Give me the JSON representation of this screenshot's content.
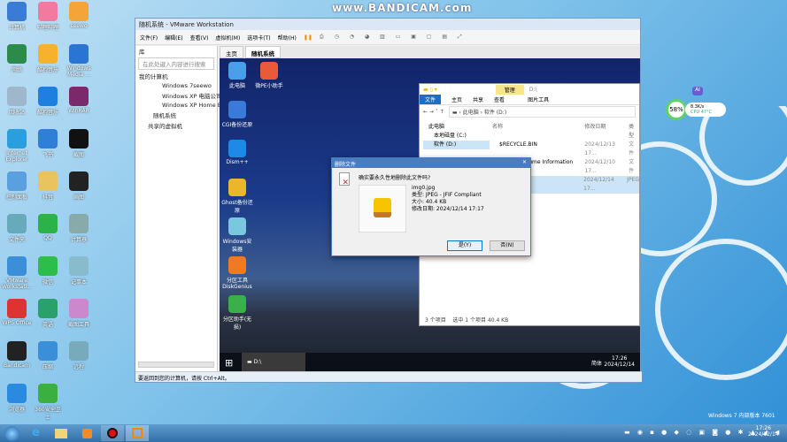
{
  "watermark": "www.BANDICAM.com",
  "host_desktop": {
    "icons": [
      "计算机",
      "哔哩哔哩",
      "seewo",
      "网络",
      "酷狗音乐",
      "Windows Media ...",
      "回收站",
      "酷狗音乐",
      "WinRAR",
      "Internet Explorer",
      "飞书",
      "截图",
      "控制面板",
      "抖音",
      "画图",
      "文件夹",
      "QQ",
      "计算器",
      "VMware Workstati...",
      "微信",
      "记事本",
      "WPS Office",
      "英语",
      "截图工具",
      "Bandicam",
      "压缩",
      "远程",
      "浏览器",
      "360安全卫士"
    ],
    "widget": {
      "ai": "AI",
      "percent": "58%",
      "speed": "8.3K/s",
      "cpu": "CPU 47°C"
    },
    "version_text": "Windows 7 内部版本 7601",
    "clock": {
      "time": "17:26",
      "date": "2024/12/14"
    }
  },
  "vmware": {
    "title": "随机系统 - VMware Workstation",
    "menu": [
      "文件(F)",
      "编辑(E)",
      "查看(V)",
      "虚拟机(M)",
      "选项卡(T)",
      "帮助(H)"
    ],
    "library": {
      "title": "库",
      "search_placeholder": "在此处键入内容进行搜索",
      "tree": [
        "我的计算机",
        "Windows 7seewo",
        "Windows XP 电脑公司",
        "Windows XP Home Ed",
        "随机系统",
        "共享的虚拟机"
      ]
    },
    "tabs": [
      "主页",
      "随机系统"
    ],
    "status": "要返回到您的计算机，请按 Ctrl+Alt。"
  },
  "guest": {
    "icons": [
      "此电脑",
      "微PE小助手",
      "CGI备份还原",
      "Dism++",
      "Ghost备份还原",
      "Windows安装器",
      "分区工具DiskGenius",
      "分区助手(无损)"
    ],
    "taskbar": {
      "task": "D:\\",
      "ime": "简体",
      "time": "17:26",
      "date": "2024/12/14"
    },
    "explorer": {
      "manage": "管理",
      "path_title": "D:\\",
      "ribbon": [
        "文件",
        "主页",
        "共享",
        "查看",
        "图片工具"
      ],
      "breadcrumb": [
        "此电脑",
        "软件 (D:)"
      ],
      "columns": [
        "名称",
        "修改日期",
        "类型"
      ],
      "nav": [
        "此电脑",
        "本地磁盘 (C:)",
        "软件 (D:)"
      ],
      "rows": [
        {
          "name": "$RECYCLE.BIN",
          "date": "2024/12/13 17...",
          "type": "文件"
        },
        {
          "name": "System Volume Information",
          "date": "2024/12/10 17...",
          "type": "文件"
        },
        {
          "name": "",
          "date": "2024/12/14 17...",
          "type": "JPEG"
        }
      ],
      "status_count": "3 个项目",
      "status_sel": "选中 1 个项目 40.4 KB"
    },
    "dialog": {
      "title": "删除文件",
      "question": "确实要永久性地删除此文件吗?",
      "file": "img0.jpg",
      "type": "类型: JPEG - JFIF Compliant",
      "size": "大小: 40.4 KB",
      "modified": "修改日期: 2024/12/14 17:17",
      "yes": "是(Y)",
      "no": "否(N)"
    }
  }
}
